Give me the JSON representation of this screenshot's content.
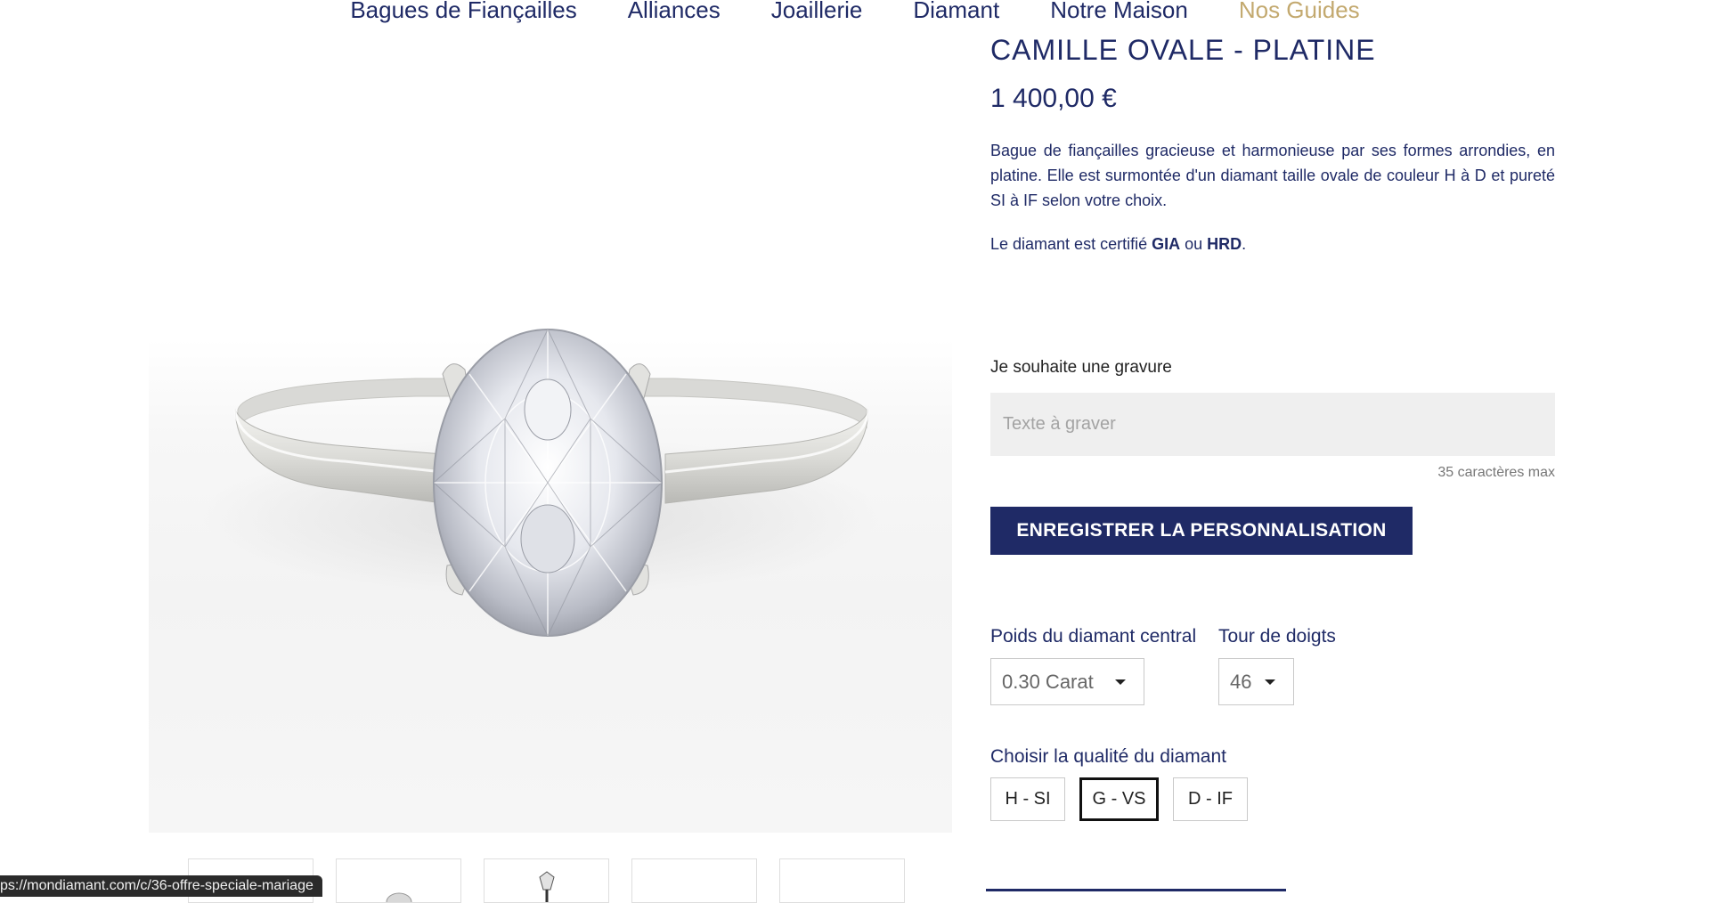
{
  "nav": {
    "items": [
      {
        "label": "Bagues de Fiançailles"
      },
      {
        "label": "Alliances"
      },
      {
        "label": "Joaillerie"
      },
      {
        "label": "Diamant"
      },
      {
        "label": "Notre Maison"
      },
      {
        "label": "Nos Guides",
        "accent": "#c3a96f"
      }
    ]
  },
  "product": {
    "title": "CAMILLE OVALE - PLATINE",
    "price": "1 400,00 €",
    "description": "Bague de fiançailles gracieuse et harmonieuse par ses formes arrondies, en platine. Elle est surmontée d'un diamant taille ovale de couleur H à D et pureté SI à IF selon votre choix.",
    "certification": {
      "prefix": "Le diamant est certifié ",
      "lab1": "GIA",
      "conjunction": " ou ",
      "lab2": "HRD",
      "suffix": "."
    }
  },
  "engraving": {
    "label": "Je souhaite une gravure",
    "placeholder": "Texte à graver",
    "value": "",
    "max_chars": "35 caractères max",
    "save_button": "ENREGISTRER LA PERSONNALISATION"
  },
  "options": {
    "weight": {
      "label": "Poids du diamant central",
      "selected": "0.30 Carat"
    },
    "finger_size": {
      "label": "Tour de doigts",
      "selected": "46"
    }
  },
  "quality": {
    "label": "Choisir la qualité du diamant",
    "options": [
      "H - SI",
      "G - VS",
      "D - IF"
    ],
    "selected": "G - VS"
  },
  "status_bar": {
    "url": "ps://mondiamant.com/c/36-offre-speciale-mariage"
  },
  "colors": {
    "brand_navy": "#1f2a66",
    "accent_gold": "#c3a96f",
    "input_bg": "#efefef"
  }
}
